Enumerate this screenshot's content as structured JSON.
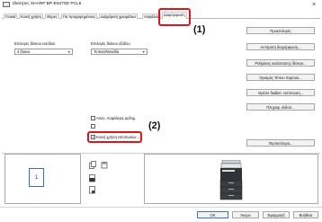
{
  "window": {
    "title": "Ιδιότητες SHARP BP-E6470D PCL6",
    "close_glyph": "×"
  },
  "tabs": [
    {
      "label": "Γενικά"
    },
    {
      "label": "Κοινή χρήση"
    },
    {
      "label": "Θύρες"
    },
    {
      "label": "Για προχωρημένους"
    },
    {
      "label": "Διαχείριση χρωμάτων"
    },
    {
      "label": "Ασφάλεια"
    },
    {
      "label": "Διαμόρφωση"
    }
  ],
  "callouts": {
    "one": "(1)",
    "two": "(2)"
  },
  "settings": {
    "trays_label": "Επιλογές δίσκου εισόδου",
    "trays_value": "4 δίσκοι",
    "output_label": "Επιλογές δίσκου εξόδου",
    "output_value": "Τυπικό/Μονάδα"
  },
  "side_buttons": [
    "Προεπιλογές",
    "Αυτόματη διαμόρφωση...",
    "Ρυθμίσεις κατάστασης δίσκου...",
    "Ορισμός Τύπου Χαρτιού...",
    "Ορίστε διαδικτ. εκτύπωση...",
    "Πληροφ. έκδοσ..."
  ],
  "checkboxes": [
    {
      "label": "Απεν. Ασφάλειας Δεδομ.",
      "checked": false
    },
    {
      "label": "",
      "checked": false
    },
    {
      "label": "Κοινή χρήση εκτυπωτών...",
      "checked": true
    }
  ],
  "more_button": "Περισσότερα...",
  "preview": {
    "page_number": "1"
  },
  "footer": {
    "ok": "ΟΚ",
    "cancel": "Άκυρο",
    "apply": "Εφαρμογή",
    "help": "Βοήθεια"
  },
  "colors": {
    "callout_box": "#e0151b",
    "primary_button_border": "#3b73c6",
    "page_outline": "#3a6fb0"
  }
}
